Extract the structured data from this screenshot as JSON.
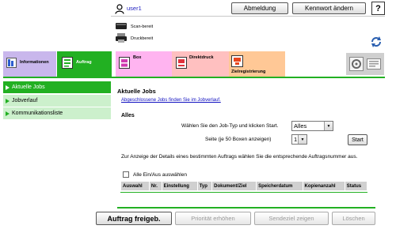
{
  "header": {
    "user_name": "user1",
    "logout_label": "Abmeldung",
    "password_label": "Kennwort ändern",
    "help_label": "?"
  },
  "status": {
    "scan": "Scan-bereit",
    "print": "Druckbereit"
  },
  "tabs": [
    {
      "label": "Informationen"
    },
    {
      "label": "Auftrag"
    },
    {
      "label": "Box"
    },
    {
      "label": "Direktdruck"
    },
    {
      "label": "Zielregistrierung"
    }
  ],
  "sidebar": {
    "items": [
      {
        "label": "Aktuelle Jobs",
        "active": true
      },
      {
        "label": "Jobverlauf",
        "active": false
      },
      {
        "label": "Kommunikationsliste",
        "active": false
      }
    ]
  },
  "main": {
    "title": "Aktuelle Jobs",
    "history_link": "Abgeschlossene Jobs finden Sie im Jobverlauf.",
    "section": "Alles",
    "job_type_label": "Wählen Sie den Job-Typ und klicken Start.",
    "job_type_value": "Alles",
    "page_label": "Seite (je 50 Boxen anzeigen)",
    "page_value": "1",
    "start_label": "Start",
    "hint": "Zur Anzeige der Details eines bestimmten Auftrags wählen Sie die entsprechende Auftragsnummer aus.",
    "select_all_label": "Alle Ein/Aus auswählen",
    "columns": [
      "Auswahl",
      "Nr.",
      "Einstellung",
      "Typ",
      "Dokument/Ziel",
      "Speicherdatum",
      "Kopienanzahl",
      "Status"
    ]
  },
  "actions": {
    "release": "Auftrag freigeb.",
    "priority": "Priorität erhöhen",
    "destination": "Sendeziel zeigen",
    "delete": "Löschen"
  },
  "colors": {
    "accent_green": "#22b022",
    "link_blue": "#1010c0"
  }
}
